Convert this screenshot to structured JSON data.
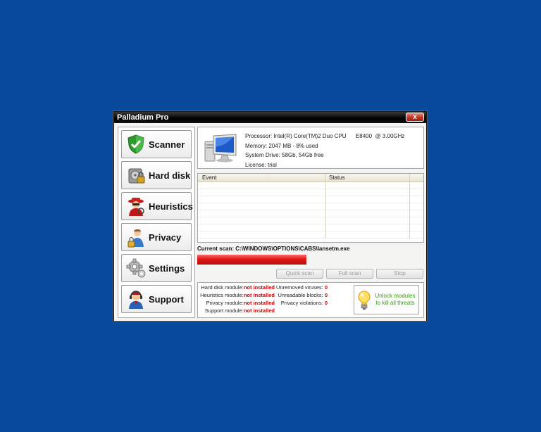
{
  "window": {
    "title": "Palladium Pro",
    "close_label": "x"
  },
  "sidebar": {
    "items": [
      {
        "label": "Scanner"
      },
      {
        "label": "Hard disk"
      },
      {
        "label": "Heuristics"
      },
      {
        "label": "Privacy"
      },
      {
        "label": "Settings"
      },
      {
        "label": "Support"
      }
    ]
  },
  "system_info": {
    "processor": "Processor: Intel(R) Core(TM)2 Duo CPU      E8400  @ 3.00GHz",
    "memory": "Memory: 2047 MB - 8% used",
    "drive": "System Drive: 58Gb, 54Gb free",
    "license": "License: trial"
  },
  "event_table": {
    "columns": [
      "Event",
      "Status"
    ],
    "rows": []
  },
  "scan": {
    "current_label": "Current scan:",
    "current_path": "C:\\WINDOWS\\OPTIONS\\CABS\\lansetm.exe",
    "progress_percent": 48
  },
  "scan_buttons": {
    "quick": "Quick scan",
    "full": "Full scan",
    "stop": "Stop"
  },
  "modules": [
    {
      "label": "Hard disk module:",
      "value": "not installed"
    },
    {
      "label": "Heuristics module:",
      "value": "not installed"
    },
    {
      "label": "Privacy module:",
      "value": "not installed"
    },
    {
      "label": "Support module:",
      "value": "not installed"
    }
  ],
  "stats": [
    {
      "label": "Unremoved viruses:",
      "value": "0"
    },
    {
      "label": "Unreadable blocks:",
      "value": "0"
    },
    {
      "label": "Privacy violations:",
      "value": "0"
    }
  ],
  "unlock": {
    "line1": "Unlock modules",
    "line2": "to kill all threats"
  },
  "colors": {
    "desktop": "#0a4a9c",
    "alert": "#cc0000",
    "unlock_text": "#3aa014"
  }
}
